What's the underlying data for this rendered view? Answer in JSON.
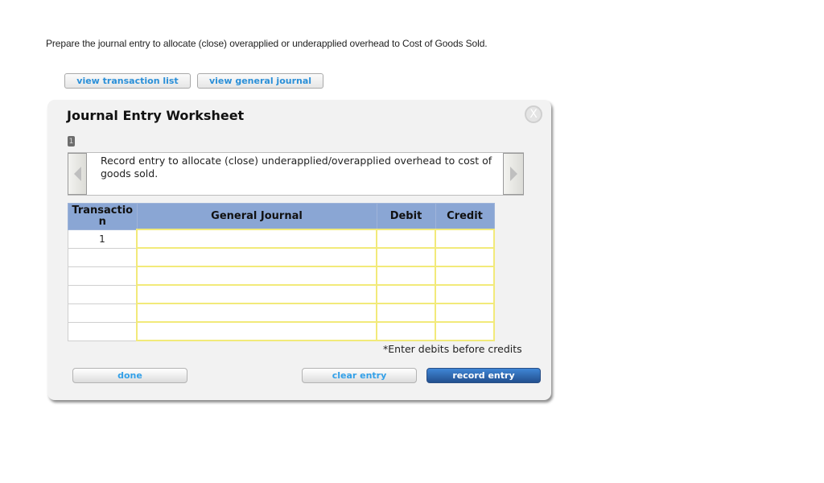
{
  "prompt": "Prepare the journal entry to allocate (close) overapplied or underapplied overhead to Cost of Goods Sold.",
  "top_buttons": {
    "view_transaction_list": "view transaction list",
    "view_general_journal": "view general journal"
  },
  "worksheet": {
    "title": "Journal Entry Worksheet",
    "close_label": "X",
    "page_number": "1",
    "description": "Record entry to allocate (close) underapplied/overapplied overhead to cost of goods sold.",
    "table": {
      "headers": [
        "Transaction",
        "General Journal",
        "Debit",
        "Credit"
      ],
      "rows": [
        {
          "transaction": "1",
          "general_journal": "",
          "debit": "",
          "credit": ""
        },
        {
          "transaction": "",
          "general_journal": "",
          "debit": "",
          "credit": ""
        },
        {
          "transaction": "",
          "general_journal": "",
          "debit": "",
          "credit": ""
        },
        {
          "transaction": "",
          "general_journal": "",
          "debit": "",
          "credit": ""
        },
        {
          "transaction": "",
          "general_journal": "",
          "debit": "",
          "credit": ""
        },
        {
          "transaction": "",
          "general_journal": "",
          "debit": "",
          "credit": ""
        }
      ]
    },
    "hint": "*Enter debits before credits",
    "buttons": {
      "done": "done",
      "clear_entry": "clear entry",
      "record_entry": "record entry"
    }
  },
  "colors": {
    "header_bg": "#8aa6d4",
    "input_border": "#f2ea7a",
    "link_blue": "#33a0e8",
    "primary_button": "#2f6bb4"
  }
}
